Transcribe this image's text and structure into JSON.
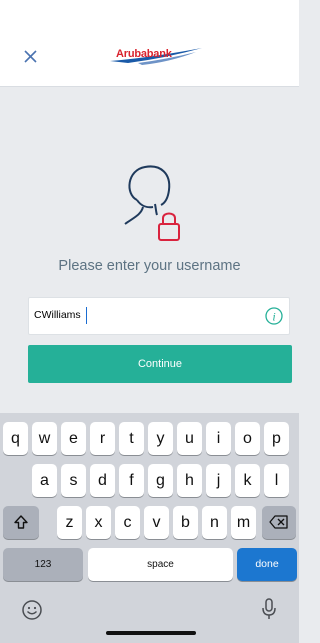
{
  "header": {
    "logo_text": "Arubabank",
    "close_icon": "close-icon"
  },
  "main": {
    "user_icon": "user-lock-icon",
    "prompt": "Please enter your username",
    "username_value": "CWilliams",
    "info_icon": "info-icon",
    "continue_label": "Continue"
  },
  "keyboard": {
    "row1": [
      "q",
      "w",
      "e",
      "r",
      "t",
      "y",
      "u",
      "i",
      "o",
      "p"
    ],
    "row2": [
      "a",
      "s",
      "d",
      "f",
      "g",
      "h",
      "j",
      "k",
      "l"
    ],
    "row3": [
      "z",
      "x",
      "c",
      "v",
      "b",
      "n",
      "m"
    ],
    "shift_icon": "shift-icon",
    "backspace_icon": "backspace-icon",
    "numbers_label": "123",
    "space_label": "space",
    "done_label": "done",
    "emoji_icon": "emoji-icon",
    "mic_icon": "microphone-icon"
  },
  "colors": {
    "accent": "#25b098",
    "brand_red": "#d9232e",
    "brand_blue": "#1a5aa8",
    "prompt_text": "#5d7383",
    "done_key": "#1c77d0"
  }
}
